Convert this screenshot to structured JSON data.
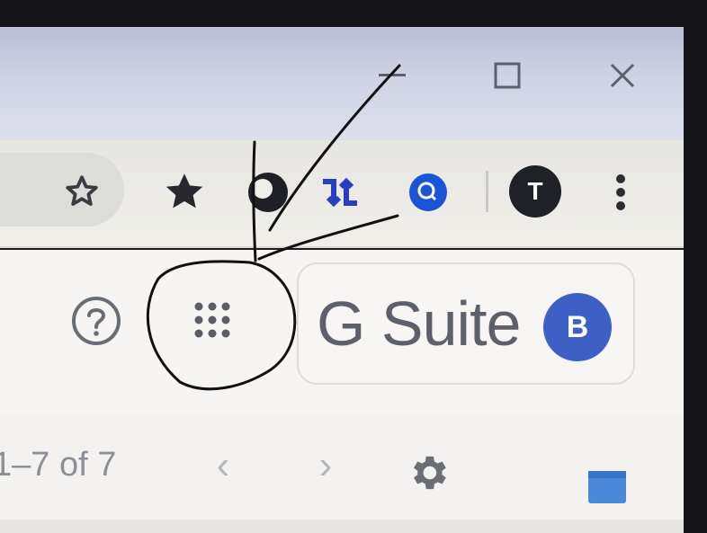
{
  "window": {
    "controls": [
      "minimize",
      "maximize",
      "close"
    ]
  },
  "browser_toolbar": {
    "icons": [
      "bookmark-star-icon",
      "filled-star-icon",
      "extension-round-icon",
      "extension-arrows-icon",
      "extension-search-icon",
      "chrome-menu-icon"
    ],
    "profile_initial": "T"
  },
  "app_header": {
    "brand": "G Suite",
    "account_initial": "B",
    "icons": [
      "help-icon",
      "apps-grid-icon"
    ]
  },
  "list_toolbar": {
    "page_range": "1–7 of 7",
    "prev_label": "‹",
    "next_label": "›",
    "icons": [
      "settings-gear-icon",
      "calendar-icon"
    ]
  },
  "colors": {
    "account_avatar": "#3e5fc4",
    "profile_avatar": "#1f2127",
    "extension_blue": "#1a55d6",
    "annotation_ink": "#111111"
  }
}
